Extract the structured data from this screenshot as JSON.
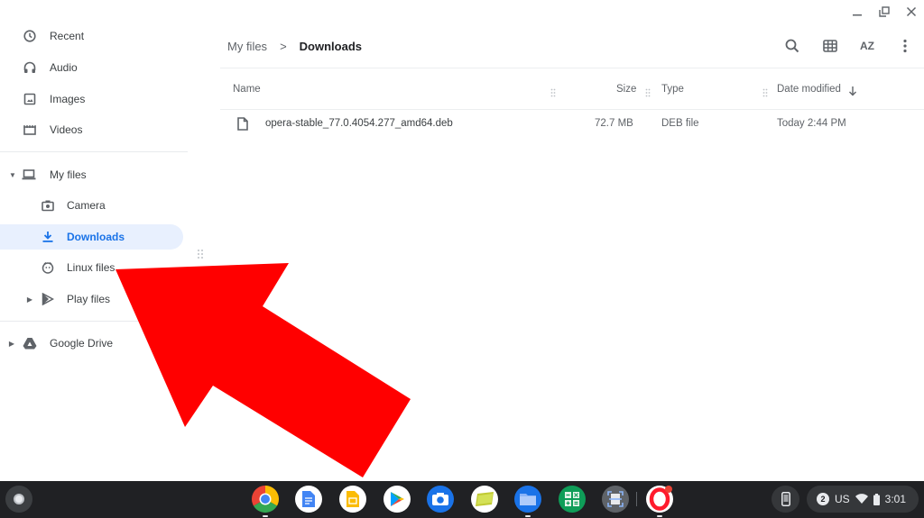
{
  "window": {
    "controls": [
      "minimize",
      "restore",
      "close"
    ]
  },
  "sidebar": {
    "items": [
      {
        "label": "Recent",
        "icon": "clock-icon"
      },
      {
        "label": "Audio",
        "icon": "headphones-icon"
      },
      {
        "label": "Images",
        "icon": "image-icon"
      },
      {
        "label": "Videos",
        "icon": "film-icon"
      },
      {
        "label": "My files",
        "icon": "laptop-icon"
      },
      {
        "label": "Camera",
        "icon": "camera-icon"
      },
      {
        "label": "Downloads",
        "icon": "download-icon",
        "active": true
      },
      {
        "label": "Linux files",
        "icon": "penguin-icon"
      },
      {
        "label": "Play files",
        "icon": "play-store-icon"
      },
      {
        "label": "Google Drive",
        "icon": "drive-icon"
      }
    ]
  },
  "breadcrumb": {
    "parent": "My files",
    "separator": ">",
    "current": "Downloads"
  },
  "toolbar": {
    "buttons": [
      "search",
      "grid-view",
      "sort",
      "more"
    ],
    "sort_label": "AZ"
  },
  "table": {
    "columns": [
      "Name",
      "Size",
      "Type",
      "Date modified"
    ],
    "sort_direction": "descending",
    "rows": [
      {
        "name": "opera-stable_77.0.4054.277_amd64.deb",
        "size": "72.7 MB",
        "type": "DEB file",
        "modified": "Today 2:44 PM"
      }
    ]
  },
  "annotation": {
    "arrow_color": "#ff0000",
    "points_to": "Linux files"
  },
  "shelf": {
    "apps": [
      "Chrome",
      "Google Docs",
      "Google Slides",
      "Play Store",
      "Camera",
      "Gallery",
      "Files",
      "Calculator",
      "Scanner",
      "Opera"
    ],
    "status": {
      "notification_count": "2",
      "keyboard": "US",
      "time": "3:01"
    }
  },
  "colors": {
    "accent": "#1a73e8",
    "active_bg": "#e8f0fe",
    "shelf_bg": "#202124"
  }
}
